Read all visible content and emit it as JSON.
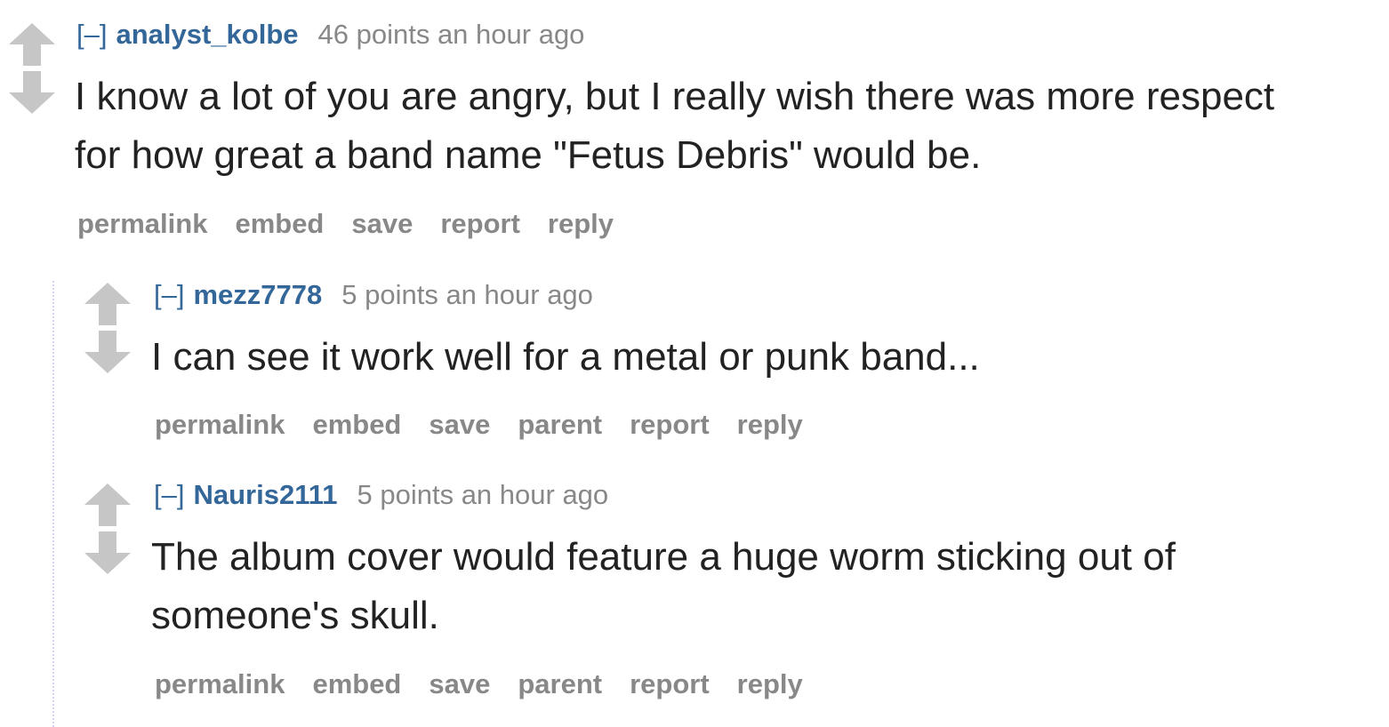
{
  "icons": {
    "upvote": "up-arrow-icon",
    "downvote": "down-arrow-icon"
  },
  "colors": {
    "link": "#336699",
    "muted": "#888888",
    "text": "#222222",
    "arrow": "#c6c6c6",
    "thread_line": "#d4d4f0"
  },
  "comments": [
    {
      "toggle": "[–]",
      "author": "analyst_kolbe",
      "score": "46 points an hour ago",
      "body_lines": [
        "I know a lot of you are angry, but I really wish there was more respect",
        "for how great a band name \"Fetus Debris\" would be."
      ],
      "buttons": [
        "permalink",
        "embed",
        "save",
        "report",
        "reply"
      ]
    },
    {
      "toggle": "[–]",
      "author": "mezz7778",
      "score": "5 points an hour ago",
      "body_lines": [
        "I can see it work well for a metal or punk band..."
      ],
      "buttons": [
        "permalink",
        "embed",
        "save",
        "parent",
        "report",
        "reply"
      ]
    },
    {
      "toggle": "[–]",
      "author": "Nauris2111",
      "score": "5 points an hour ago",
      "body_lines": [
        "The album cover would feature a huge worm sticking out of",
        "someone's skull."
      ],
      "buttons": [
        "permalink",
        "embed",
        "save",
        "parent",
        "report",
        "reply"
      ]
    }
  ]
}
